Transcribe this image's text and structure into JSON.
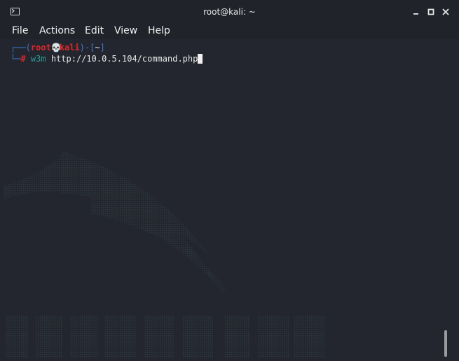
{
  "window": {
    "title": "root@kali: ~",
    "icons": {
      "app": "terminal-icon",
      "minimize": "minimize-icon",
      "maximize": "maximize-icon",
      "close": "close-icon"
    }
  },
  "menubar": {
    "items": [
      "File",
      "Actions",
      "Edit",
      "View",
      "Help"
    ]
  },
  "terminal": {
    "prompt": {
      "corner_top": "┌──(",
      "user": "root",
      "skull": "💀",
      "host": "kali",
      "sep": ")-[",
      "path": "~",
      "close": "]",
      "corner_bottom": "└─",
      "hash": "#"
    },
    "command": "w3m",
    "argument": "http://10.0.5.104/command.php"
  },
  "colors": {
    "background": "#23262e",
    "prompt_frame": "#3a7bd5",
    "prompt_user": "#e0272b",
    "command": "#2f9c95",
    "text": "#e8e8e8"
  }
}
